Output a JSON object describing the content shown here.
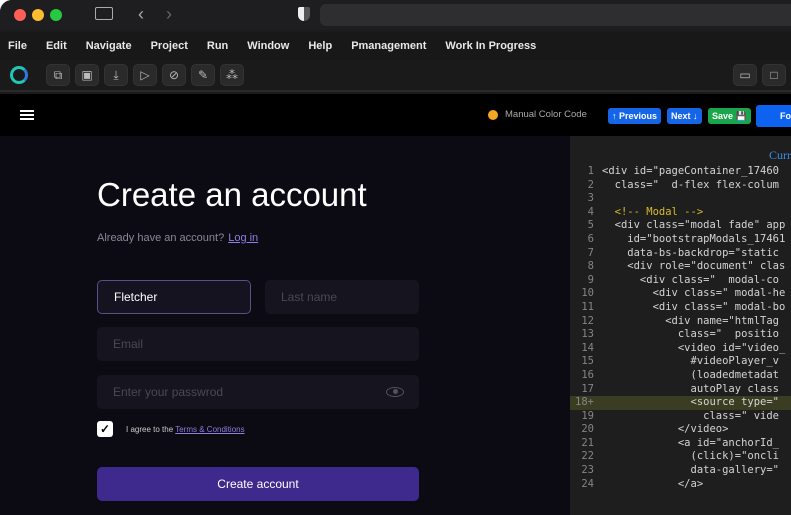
{
  "menu": [
    "File",
    "Edit",
    "Navigate",
    "Project",
    "Run",
    "Window",
    "Help",
    "Pmanagement",
    "Work In Progress"
  ],
  "toolbar_icons": [
    "copy-icon",
    "save-icon",
    "download-icon",
    "play-icon",
    "stop-icon",
    "edit-icon",
    "components-icon"
  ],
  "header": {
    "manual_color_label": "Manual Color Code",
    "manual_color": "#f5a623",
    "previous": "↑ Previous",
    "next": "Next ↓",
    "save": "Save 💾",
    "fo": "Fo"
  },
  "form": {
    "title": "Create an account",
    "already": "Already have an account?",
    "login": "Log in",
    "first_name": "Fletcher",
    "last_name_placeholder": "Last name",
    "email_placeholder": "Email",
    "password_placeholder": "Enter your passwrod",
    "agree": "I agree to the",
    "terms": "Terms & Conditions",
    "submit": "Create account"
  },
  "code": {
    "header": "Curr",
    "lines": [
      {
        "n": "1",
        "t": "<div id=\"pageContainer_17460"
      },
      {
        "n": "2",
        "t": "  class=\"  d-flex flex-colum"
      },
      {
        "n": "3",
        "t": ""
      },
      {
        "n": "4",
        "t": "  <!-- Modal -->"
      },
      {
        "n": "5",
        "t": "  <div class=\"modal fade\" app"
      },
      {
        "n": "6",
        "t": "    id=\"bootstrapModals_17461"
      },
      {
        "n": "7",
        "t": "    data-bs-backdrop=\"static"
      },
      {
        "n": "8",
        "t": "    <div role=\"document\" clas"
      },
      {
        "n": "9",
        "t": "      <div class=\"  modal-co"
      },
      {
        "n": "10",
        "t": "        <div class=\" modal-he"
      },
      {
        "n": "11",
        "t": "        <div class=\" modal-bo"
      },
      {
        "n": "12",
        "t": "          <div name=\"htmlTag"
      },
      {
        "n": "13",
        "t": "            class=\"  positio"
      },
      {
        "n": "14",
        "t": "            <video id=\"video_"
      },
      {
        "n": "15",
        "t": "              #videoPlayer_v"
      },
      {
        "n": "16",
        "t": "              (loadedmetadat"
      },
      {
        "n": "17",
        "t": "              autoPlay class"
      },
      {
        "n": "18+",
        "t": "              <source type=\""
      },
      {
        "n": "19",
        "t": "                class=\" vide"
      },
      {
        "n": "20",
        "t": "            </video>"
      },
      {
        "n": "21",
        "t": "            <a id=\"anchorId_"
      },
      {
        "n": "22",
        "t": "              (click)=\"oncli"
      },
      {
        "n": "23",
        "t": "              data-gallery=\""
      },
      {
        "n": "24",
        "t": "            </a>"
      }
    ]
  }
}
